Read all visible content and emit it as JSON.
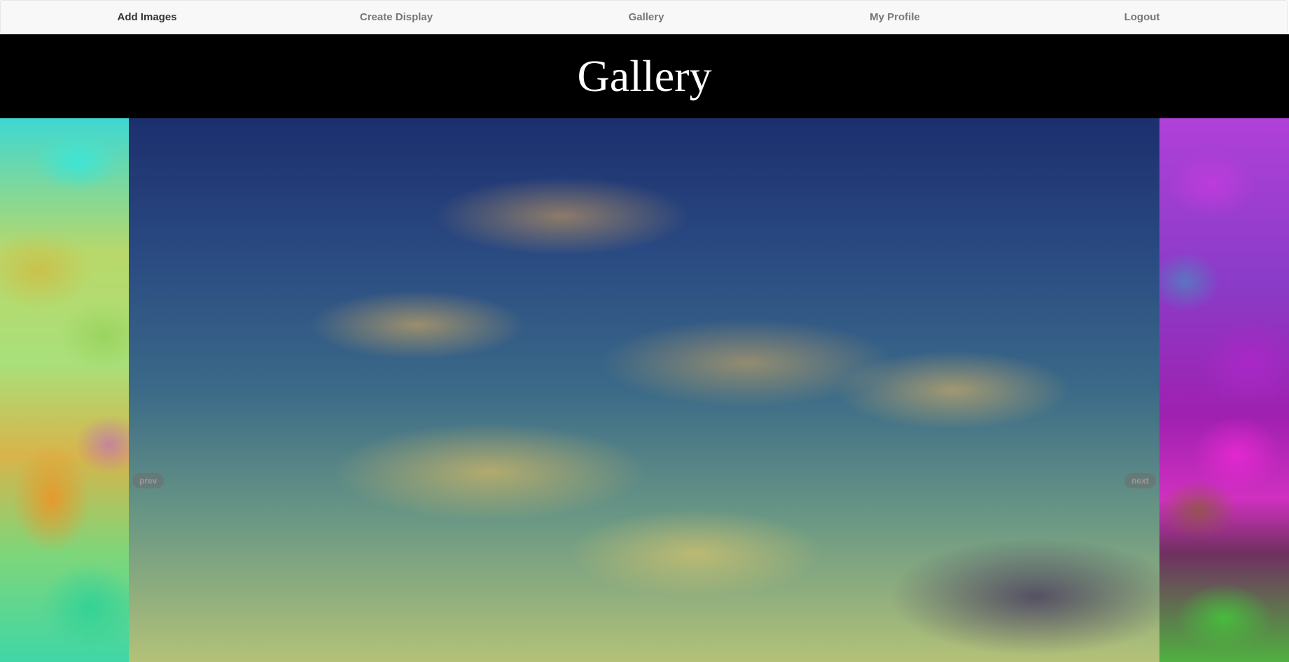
{
  "navbar": {
    "items": [
      {
        "label": "Add Images",
        "active": true
      },
      {
        "label": "Create Display",
        "active": false
      },
      {
        "label": "Gallery",
        "active": false
      },
      {
        "label": "My Profile",
        "active": false
      },
      {
        "label": "Logout",
        "active": false
      }
    ]
  },
  "header": {
    "title": "Gallery"
  },
  "carousel": {
    "prev_label": "prev",
    "next_label": "next",
    "left_image": "abstract-teal-green-orange-marble-image",
    "main_image": "sunset-sky-clouds-image",
    "right_image": "abstract-purple-magenta-marble-image"
  },
  "colors": {
    "navbar_bg": "#f8f8f8",
    "header_bg": "#000000",
    "title_color": "#ffffff",
    "nav_text": "#777777",
    "nav_active_text": "#333333"
  }
}
